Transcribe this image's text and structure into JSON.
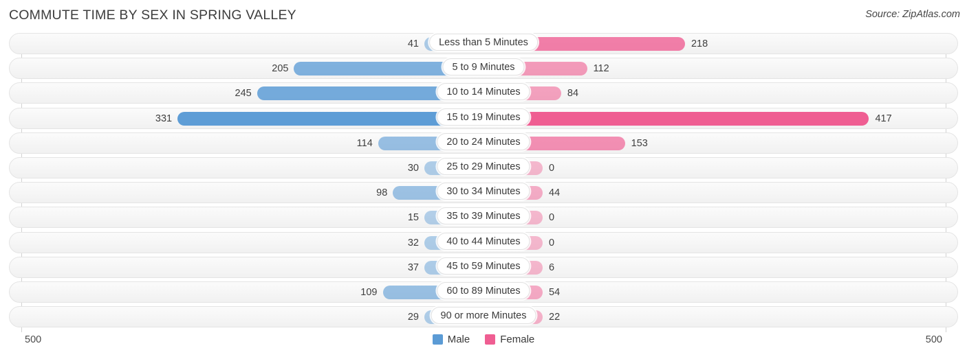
{
  "header": {
    "title": "COMMUTE TIME BY SEX IN SPRING VALLEY",
    "source": "Source: ZipAtlas.com"
  },
  "axis": {
    "left_tick": "500",
    "right_tick": "500"
  },
  "legend": [
    {
      "label": "Male",
      "color": "#5b9bd5",
      "name": "legend-item-male"
    },
    {
      "label": "Female",
      "color": "#ef5e92",
      "name": "legend-item-female"
    }
  ],
  "colors": {
    "male": "#5b9bd5",
    "female": "#ef5e92",
    "track": "#f4f4f4",
    "axis": "#d2d2d2"
  },
  "chart_data": {
    "type": "bar",
    "title": "COMMUTE TIME BY SEX IN SPRING VALLEY",
    "subtitle": "Source: ZipAtlas.com",
    "orientation": "horizontal-diverging",
    "xlabel": "",
    "ylabel": "",
    "xlim": [
      -500,
      500
    ],
    "axis_max": 500,
    "grid": false,
    "legend_position": "bottom-center",
    "categories": [
      "Less than 5 Minutes",
      "5 to 9 Minutes",
      "10 to 14 Minutes",
      "15 to 19 Minutes",
      "20 to 24 Minutes",
      "25 to 29 Minutes",
      "30 to 34 Minutes",
      "35 to 39 Minutes",
      "40 to 44 Minutes",
      "45 to 59 Minutes",
      "60 to 89 Minutes",
      "90 or more Minutes"
    ],
    "series": [
      {
        "name": "Male",
        "color": "#5b9bd5",
        "side": "left",
        "values": [
          41,
          205,
          245,
          331,
          114,
          30,
          98,
          15,
          32,
          37,
          109,
          29
        ]
      },
      {
        "name": "Female",
        "color": "#ef5e92",
        "side": "right",
        "values": [
          218,
          112,
          84,
          417,
          153,
          0,
          44,
          0,
          0,
          6,
          54,
          22
        ]
      }
    ]
  },
  "rows": [
    {
      "label": "Less than 5 Minutes",
      "male": "41",
      "female": "218"
    },
    {
      "label": "5 to 9 Minutes",
      "male": "205",
      "female": "112"
    },
    {
      "label": "10 to 14 Minutes",
      "male": "245",
      "female": "84"
    },
    {
      "label": "15 to 19 Minutes",
      "male": "331",
      "female": "417"
    },
    {
      "label": "20 to 24 Minutes",
      "male": "114",
      "female": "153"
    },
    {
      "label": "25 to 29 Minutes",
      "male": "30",
      "female": "0"
    },
    {
      "label": "30 to 34 Minutes",
      "male": "98",
      "female": "44"
    },
    {
      "label": "35 to 39 Minutes",
      "male": "15",
      "female": "0"
    },
    {
      "label": "40 to 44 Minutes",
      "male": "32",
      "female": "0"
    },
    {
      "label": "45 to 59 Minutes",
      "male": "37",
      "female": "6"
    },
    {
      "label": "60 to 89 Minutes",
      "male": "109",
      "female": "54"
    },
    {
      "label": "90 or more Minutes",
      "male": "29",
      "female": "22"
    }
  ]
}
